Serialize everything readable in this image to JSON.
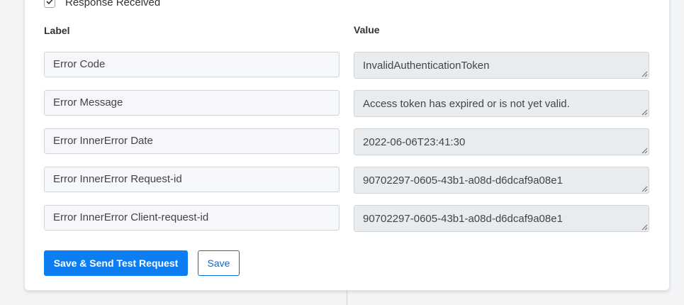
{
  "response": {
    "checkbox_label": "Response Received",
    "checked": true
  },
  "table": {
    "label_header": "Label",
    "value_header": "Value",
    "rows": [
      {
        "label": "Error Code",
        "value": "InvalidAuthenticationToken"
      },
      {
        "label": "Error Message",
        "value": "Access token has expired or is not yet valid."
      },
      {
        "label": "Error InnerError Date",
        "value": "2022-06-06T23:41:30"
      },
      {
        "label": "Error InnerError Request-id",
        "value": "90702297-0605-43b1-a08d-d6dcaf9a08e1"
      },
      {
        "label": "Error InnerError Client-request-id",
        "value": "90702297-0605-43b1-a08d-d6dcaf9a08e1"
      }
    ]
  },
  "actions": {
    "save_send_label": "Save & Send Test Request",
    "save_label": "Save"
  },
  "colors": {
    "primary": "#0d7ef2",
    "outline": "#0a6ad6"
  }
}
